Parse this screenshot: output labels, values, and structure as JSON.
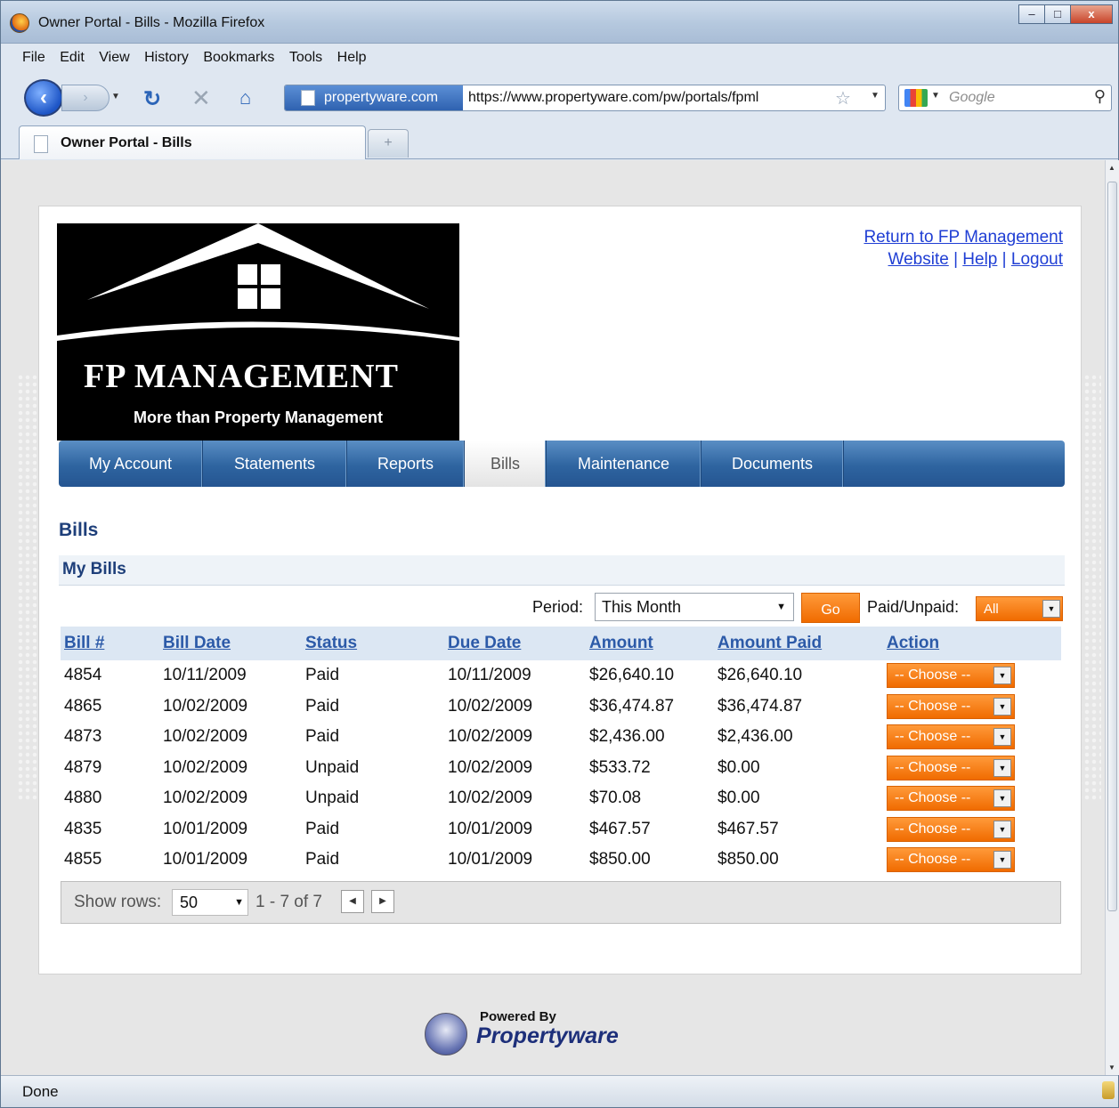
{
  "window": {
    "title": "Owner Portal - Bills - Mozilla Firefox",
    "min_label": "–",
    "max_label": "□",
    "close_label": "x"
  },
  "menu": [
    "File",
    "Edit",
    "View",
    "History",
    "Bookmarks",
    "Tools",
    "Help"
  ],
  "urlbar": {
    "site": "propertyware.com",
    "url": "https://www.propertyware.com/pw/portals/fpml"
  },
  "search": {
    "placeholder": "Google"
  },
  "tab": {
    "label": "Owner Portal - Bills",
    "new_tab": "+"
  },
  "header": {
    "logo_title": "FP MANAGEMENT",
    "logo_subtitle": "More than Property Management",
    "return_link": "Return to FP Management",
    "website_link": "Website",
    "help_link": "Help",
    "logout_link": "Logout",
    "separator": "|"
  },
  "nav": [
    {
      "label": "My Account",
      "width": 162
    },
    {
      "label": "Statements",
      "width": 162
    },
    {
      "label": "Reports",
      "width": 132
    },
    {
      "label": "Bills",
      "width": 92,
      "active": true
    },
    {
      "label": "Maintenance",
      "width": 174
    },
    {
      "label": "Documents",
      "width": 160
    }
  ],
  "page": {
    "title": "Bills",
    "section": "My Bills"
  },
  "filters": {
    "period_label": "Period:",
    "period_value": "This Month",
    "go_label": "Go",
    "paid_label": "Paid/Unpaid:",
    "paid_value": "All"
  },
  "table": {
    "columns": [
      "Bill #",
      "Bill Date",
      "Status",
      "Due Date",
      "Amount",
      "Amount Paid",
      "Action"
    ],
    "rows": [
      [
        "4854",
        "10/11/2009",
        "Paid",
        "10/11/2009",
        "$26,640.10",
        "$26,640.10"
      ],
      [
        "4865",
        "10/02/2009",
        "Paid",
        "10/02/2009",
        "$36,474.87",
        "$36,474.87"
      ],
      [
        "4873",
        "10/02/2009",
        "Paid",
        "10/02/2009",
        "$2,436.00",
        "$2,436.00"
      ],
      [
        "4879",
        "10/02/2009",
        "Unpaid",
        "10/02/2009",
        "$533.72",
        "$0.00"
      ],
      [
        "4880",
        "10/02/2009",
        "Unpaid",
        "10/02/2009",
        "$70.08",
        "$0.00"
      ],
      [
        "4835",
        "10/01/2009",
        "Paid",
        "10/01/2009",
        "$467.57",
        "$467.57"
      ],
      [
        "4855",
        "10/01/2009",
        "Paid",
        "10/01/2009",
        "$850.00",
        "$850.00"
      ]
    ],
    "action_label": "-- Choose --"
  },
  "pager": {
    "rows_label": "Show rows:",
    "rows_value": "50",
    "range": "1 - 7 of 7"
  },
  "footer": {
    "powered_by": "Powered By",
    "brand": "Propertyware"
  },
  "status": "Done"
}
